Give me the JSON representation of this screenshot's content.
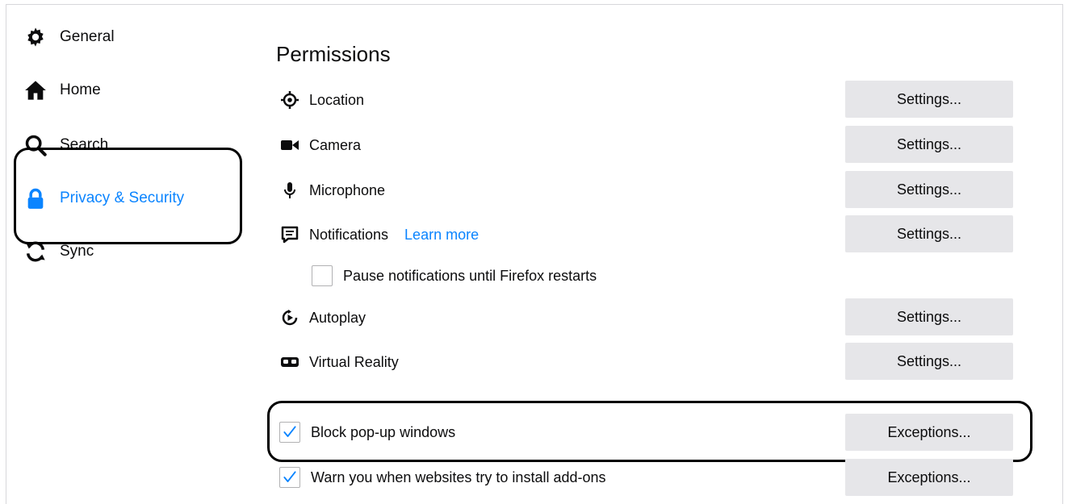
{
  "sidebar": {
    "items": [
      {
        "label": "General",
        "icon": "gear-icon"
      },
      {
        "label": "Home",
        "icon": "home-icon"
      },
      {
        "label": "Search",
        "icon": "search-icon"
      },
      {
        "label": "Privacy & Security",
        "icon": "lock-icon",
        "selected": true
      },
      {
        "label": "Sync",
        "icon": "sync-icon"
      }
    ]
  },
  "permissions": {
    "title": "Permissions",
    "rows": [
      {
        "label": "Location",
        "icon": "location-icon",
        "button": "Settings..."
      },
      {
        "label": "Camera",
        "icon": "camera-icon",
        "button": "Settings..."
      },
      {
        "label": "Microphone",
        "icon": "microphone-icon",
        "button": "Settings..."
      },
      {
        "label": "Notifications",
        "icon": "notifications-icon",
        "button": "Settings...",
        "link": "Learn more"
      },
      {
        "label": "Autoplay",
        "icon": "autoplay-icon",
        "button": "Settings..."
      },
      {
        "label": "Virtual Reality",
        "icon": "vr-icon",
        "button": "Settings..."
      }
    ],
    "pause_notifications": {
      "label": "Pause notifications until Firefox restarts",
      "checked": false
    },
    "block_popups": {
      "label": "Block pop-up windows",
      "checked": true,
      "button": "Exceptions..."
    },
    "warn_addons": {
      "label": "Warn you when websites try to install add-ons",
      "checked": true,
      "button": "Exceptions..."
    }
  },
  "colors": {
    "accent": "#0a84ff",
    "button_bg": "#e6e6e9",
    "text": "#0c0c0d"
  }
}
